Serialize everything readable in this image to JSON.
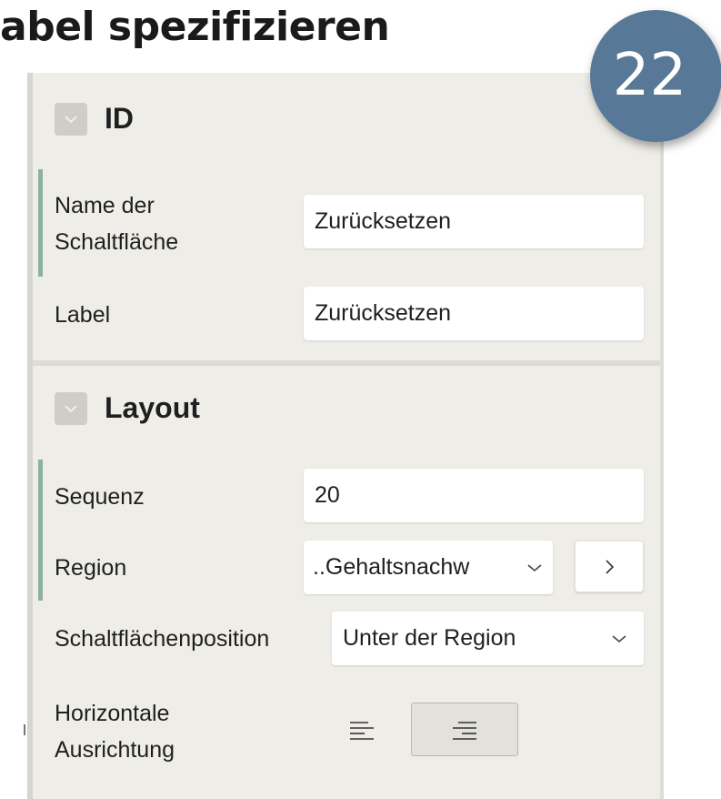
{
  "page": {
    "heading": "abel spezifizieren",
    "step_number": "22"
  },
  "sections": {
    "id": {
      "title": "ID",
      "fields": {
        "button_name": {
          "label": "Name der Schaltfläche",
          "label_line1": "Name der",
          "label_line2": "Schaltfläche",
          "value": "Zurücksetzen"
        },
        "label": {
          "label": "Label",
          "value": "Zurücksetzen"
        }
      }
    },
    "layout": {
      "title": "Layout",
      "fields": {
        "sequence": {
          "label": "Sequenz",
          "value": "20"
        },
        "region": {
          "label": "Region",
          "value": "..Gehaltsnachw"
        },
        "button_position": {
          "label": "Schaltflächenposition",
          "value": "Unter der Region"
        },
        "horizontal_alignment": {
          "label": "Horizontale Ausrichtung",
          "label_line1": "Horizontale",
          "label_line2": "Ausrichtung",
          "options": [
            "left-align-icon",
            "right-align-icon"
          ],
          "selected": "right"
        }
      }
    }
  },
  "colors": {
    "panel_bg": "#eeede7",
    "badge_bg": "#587898",
    "required_indicator": "#8db29a",
    "collapse_button": "#d0cdc8"
  }
}
